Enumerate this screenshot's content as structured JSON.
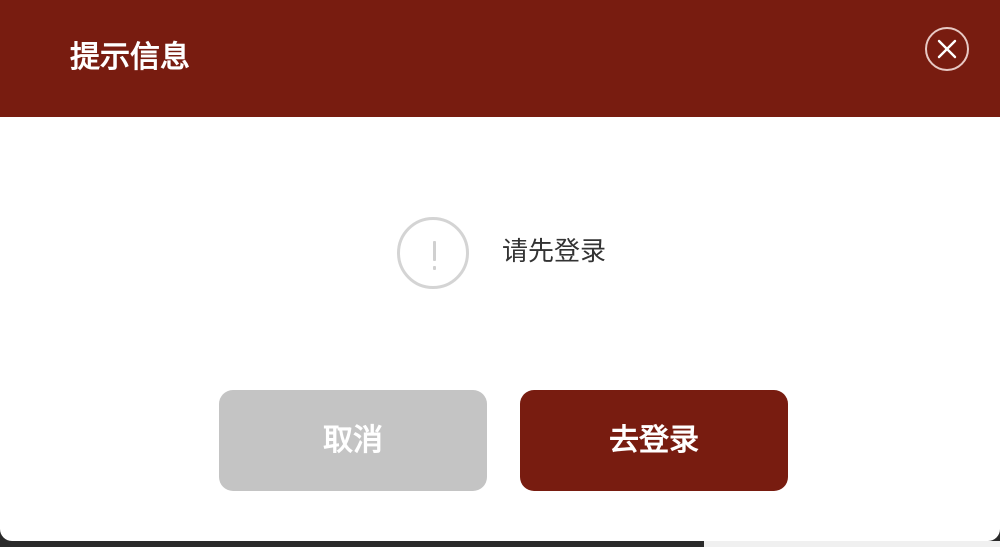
{
  "dialog": {
    "title": "提示信息",
    "close_icon": "close-icon",
    "message": "请先登录",
    "message_icon": "warning-icon",
    "cancel_label": "取消",
    "confirm_label": "去登录"
  },
  "colors": {
    "header": "#781c10",
    "confirm_button": "#781c10",
    "cancel_button": "#c4c4c4",
    "body": "#ffffff"
  }
}
